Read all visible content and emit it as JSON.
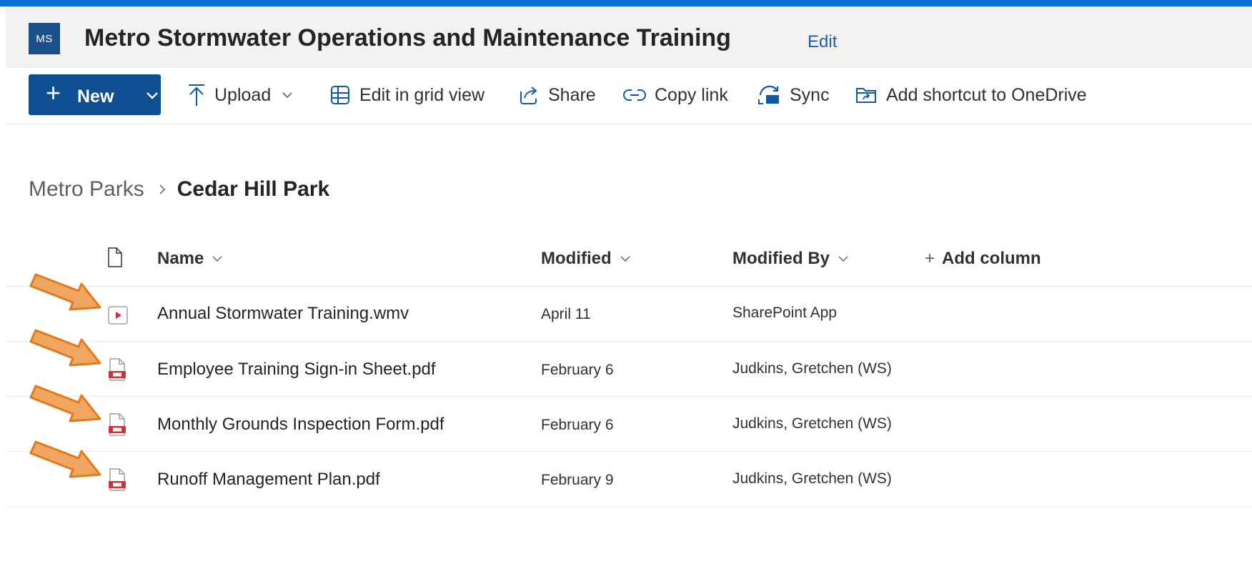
{
  "site": {
    "logo_initials": "MS",
    "title": "Metro Stormwater Operations and Maintenance Training",
    "edit_label": "Edit",
    "accent_color": "#0a6fd0",
    "logo_color": "#1b4f8c"
  },
  "commandbar": {
    "new_label": "New",
    "upload_label": "Upload",
    "grid_label": "Edit in grid view",
    "share_label": "Share",
    "copylink_label": "Copy link",
    "sync_label": "Sync",
    "shortcut_label": "Add shortcut to OneDrive",
    "new_button_color": "#0d4f91"
  },
  "breadcrumb": {
    "parent": "Metro Parks",
    "current": "Cedar Hill Park"
  },
  "list": {
    "columns": {
      "name": "Name",
      "modified": "Modified",
      "modified_by": "Modified By",
      "add_column": "Add column"
    },
    "files": [
      {
        "name": "Annual Stormwater Training.wmv",
        "modified": "April 11",
        "modified_by": "SharePoint App",
        "icon": "video-file-icon"
      },
      {
        "name": "Employee Training Sign-in Sheet.pdf",
        "modified": "February 6",
        "modified_by": "Judkins, Gretchen (WS)",
        "icon": "pdf-file-icon"
      },
      {
        "name": "Monthly Grounds Inspection Form.pdf",
        "modified": "February 6",
        "modified_by": "Judkins, Gretchen (WS)",
        "icon": "pdf-file-icon"
      },
      {
        "name": "Runoff Management Plan.pdf",
        "modified": "February 9",
        "modified_by": "Judkins, Gretchen (WS)",
        "icon": "pdf-file-icon"
      }
    ]
  },
  "annotations": {
    "arrow_color": "#f0a560",
    "arrow_outline_color": "#e07a1b",
    "arrow_count": 4
  }
}
